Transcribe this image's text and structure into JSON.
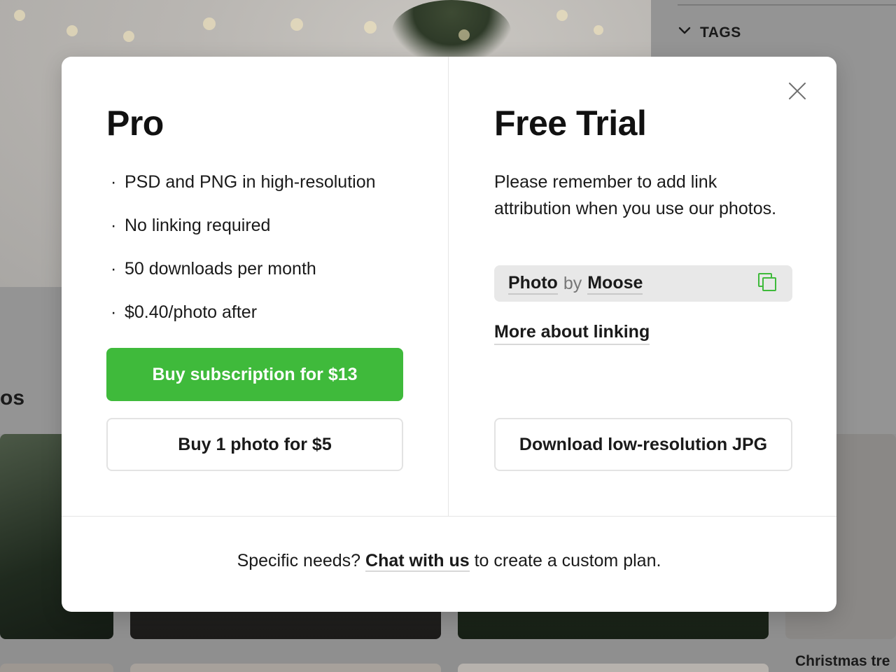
{
  "background": {
    "sidebar_heading": "TAGS",
    "section_heading_fragment": "os",
    "tile_caption": "Christmas tre"
  },
  "modal": {
    "close_icon": "close-icon",
    "pro": {
      "title": "Pro",
      "bullet": "·",
      "features": [
        "PSD and PNG in high-resolution",
        "No linking required",
        "50 downloads per month",
        "$0.40/photo after"
      ],
      "subscribe_button": "Buy subscription for $13",
      "single_photo_button": "Buy 1 photo for $5"
    },
    "free_trial": {
      "title": "Free Trial",
      "description": "Please remember to add link attribution when you use our photos.",
      "attribution": {
        "photo_label": "Photo",
        "by_label": "by",
        "author": "Moose",
        "copy_icon": "copy-icon"
      },
      "more_link": "More about linking",
      "download_button": "Download low-resolution JPG"
    },
    "footer": {
      "prefix": "Specific needs?",
      "link": "Chat with us",
      "suffix": "to create a custom plan."
    }
  },
  "colors": {
    "primary_green": "#3fba3b",
    "copy_icon_green": "#3fba3b",
    "overlay_gray": "#8f8f8f"
  }
}
